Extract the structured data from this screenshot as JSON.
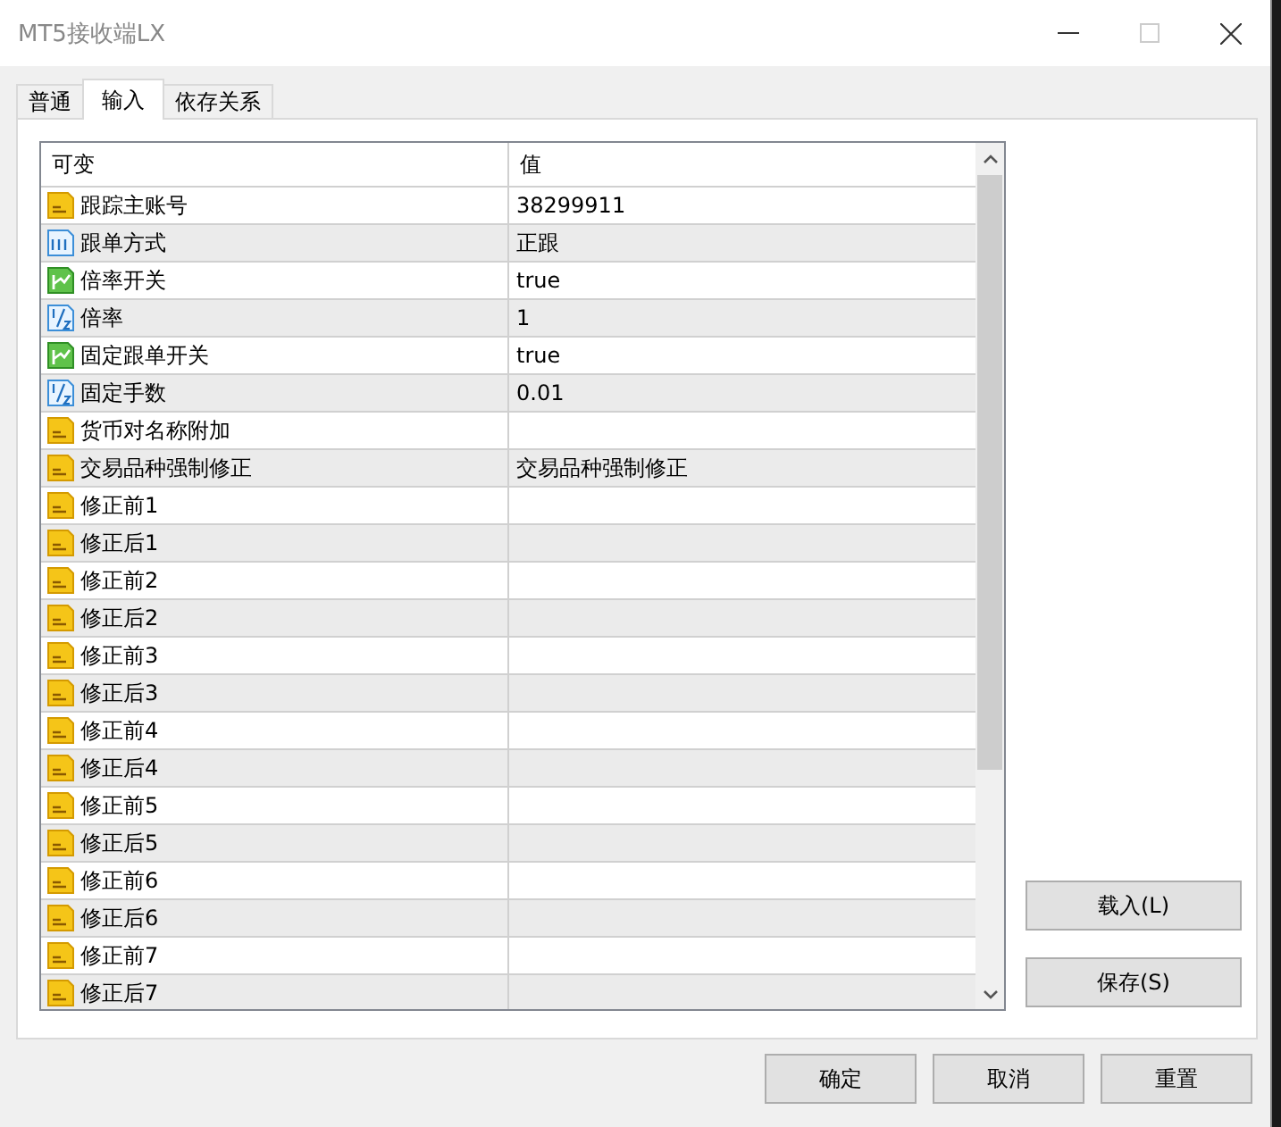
{
  "window": {
    "title": "MT5接收端LX"
  },
  "tabs": [
    {
      "label": "普通",
      "selected": false
    },
    {
      "label": "输入",
      "selected": true
    },
    {
      "label": "依存关系",
      "selected": false
    }
  ],
  "table": {
    "columns": [
      "可变",
      "值"
    ],
    "rows": [
      {
        "kind": "string",
        "name": "跟踪主账号",
        "value": "38299911"
      },
      {
        "kind": "integer",
        "name": "跟单方式",
        "value": "正跟"
      },
      {
        "kind": "bool",
        "name": "倍率开关",
        "value": "true"
      },
      {
        "kind": "double",
        "name": "倍率",
        "value": "1"
      },
      {
        "kind": "bool",
        "name": "固定跟单开关",
        "value": "true"
      },
      {
        "kind": "double",
        "name": "固定手数",
        "value": "0.01"
      },
      {
        "kind": "string",
        "name": "货币对名称附加"
      },
      {
        "kind": "string",
        "name": "交易品种强制修正",
        "value": "交易品种强制修正"
      },
      {
        "kind": "string",
        "name": "修正前1"
      },
      {
        "kind": "string",
        "name": "修正后1"
      },
      {
        "kind": "string",
        "name": "修正前2"
      },
      {
        "kind": "string",
        "name": "修正后2"
      },
      {
        "kind": "string",
        "name": "修正前3"
      },
      {
        "kind": "string",
        "name": "修正后3"
      },
      {
        "kind": "string",
        "name": "修正前4"
      },
      {
        "kind": "string",
        "name": "修正后4"
      },
      {
        "kind": "string",
        "name": "修正前5"
      },
      {
        "kind": "string",
        "name": "修正后5"
      },
      {
        "kind": "string",
        "name": "修正前6"
      },
      {
        "kind": "string",
        "name": "修正后6"
      },
      {
        "kind": "string",
        "name": "修正前7"
      },
      {
        "kind": "string",
        "name": "修正后7"
      }
    ]
  },
  "side_buttons": [
    "载入(L)",
    "保存(S)"
  ],
  "buttons": [
    "确定",
    "取消",
    "重置"
  ]
}
